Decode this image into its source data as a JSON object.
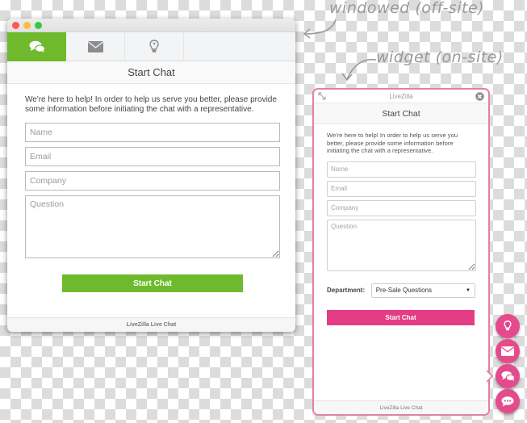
{
  "annotations": {
    "windowed": "windowed (off-site)",
    "widget": "widget (on-site)"
  },
  "windowed": {
    "tabs": [
      {
        "name": "chat",
        "icon": "chat-bubbles-icon",
        "active": true
      },
      {
        "name": "email",
        "icon": "envelope-icon",
        "active": false
      },
      {
        "name": "knowledgebase",
        "icon": "lightbulb-icon",
        "active": false
      }
    ],
    "header_title": "Start Chat",
    "intro_text": "We're here to help! In order to help us serve you better, please provide some information before initiating the chat with a representative.",
    "fields": {
      "name_placeholder": "Name",
      "email_placeholder": "Email",
      "company_placeholder": "Company",
      "question_placeholder": "Question"
    },
    "submit_label": "Start Chat",
    "footer": "LiveZilla Live Chat",
    "accent_color": "#6fba2c"
  },
  "widget": {
    "title": "LiveZilla",
    "header_title": "Start Chat",
    "intro_text": "We're here to help! In order to help us serve you better, please provide some information before initiating the chat with a representative.",
    "fields": {
      "name_placeholder": "Name",
      "email_placeholder": "Email",
      "company_placeholder": "Company",
      "question_placeholder": "Question"
    },
    "department_label": "Department:",
    "department_selected": "Pre-Sale Questions",
    "submit_label": "Start Chat",
    "footer": "LiveZilla Live Chat",
    "accent_color": "#e53d84",
    "launchers": [
      {
        "name": "knowledgebase",
        "icon": "lightbulb-icon"
      },
      {
        "name": "email",
        "icon": "envelope-icon"
      },
      {
        "name": "chat",
        "icon": "chat-bubbles-icon"
      },
      {
        "name": "quick-message",
        "icon": "speech-bubble-dots-icon"
      }
    ]
  }
}
